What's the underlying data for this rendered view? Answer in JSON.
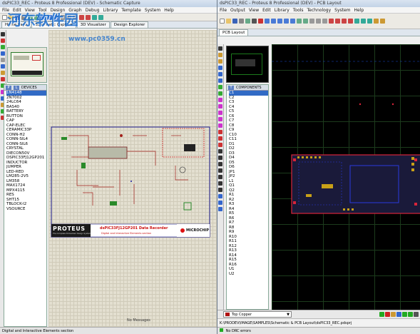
{
  "left": {
    "title": "dsPIC33_REC - Proteus 8 Professional (DEV) - Schematic Capture",
    "menu": [
      "File",
      "Edit",
      "View",
      "Tool",
      "Design",
      "Graph",
      "Debug",
      "Library",
      "Template",
      "System",
      "Help"
    ],
    "tabs": [
      {
        "label": "Home Page",
        "active": false
      },
      {
        "label": "Schematic Capture",
        "active": true
      },
      {
        "label": "3D Visualizer",
        "active": false
      },
      {
        "label": "Design Explorer",
        "active": false
      }
    ],
    "devices_header": "DEVICES",
    "devices_btn_p": "P",
    "devices_btn_l": "L",
    "devices": [
      "1N4148",
      "2N7002",
      "24LC64",
      "BAS40",
      "BATTERY",
      "BUTTON",
      "CAP",
      "CAP-ELEC",
      "CERAMIC33P",
      "CONN-H2",
      "CONN-SIL4",
      "CONN-SIL6",
      "CRYSTAL",
      "DIECON50V",
      "DSPIC33FJ12GP201",
      "INDUCTOR",
      "JUMPER",
      "LED-RED",
      "LM285-2V5",
      "LM358",
      "MAX1724",
      "MPX4115",
      "RES",
      "SHT15",
      "TBLOCK-I2",
      "VSOURCE"
    ],
    "selected_device": "1N4148",
    "banner_logo": "PROTEUS",
    "banner_tagline": "The Complete Embedded Design System",
    "banner_title": "dsPIC33FJ12GP201 Data Recorder",
    "banner_subtitle": "Digital and Interactive Elements section",
    "banner_brand": "MICROCHIP",
    "status_messages": "No Messages",
    "status_sheet": "Digital and Interactive Elements section"
  },
  "right": {
    "title": "dsPIC33_REC - Proteus 8 Professional (DEV) - PCB Layout",
    "menu": [
      "File",
      "Output",
      "View",
      "Edit",
      "Library",
      "Tools",
      "Technology",
      "System",
      "Help"
    ],
    "tab": "PCB Layout",
    "components_header": "COMPONENTS",
    "components_btn_t": "T",
    "components": [
      "C1",
      "C2",
      "C3",
      "C4",
      "C5",
      "C6",
      "C7",
      "C8",
      "C9",
      "C10",
      "C11",
      "D1",
      "D2",
      "D3",
      "D4",
      "D5",
      "D6",
      "JP1",
      "JP2",
      "L1",
      "Q1",
      "Q2",
      "R1",
      "R2",
      "R3",
      "R4",
      "R5",
      "R6",
      "R7",
      "R8",
      "R9",
      "R10",
      "R11",
      "R12",
      "R13",
      "R14",
      "R15",
      "R16",
      "U1",
      "U2"
    ],
    "selected_component": "C1",
    "layer": "Top Copper",
    "path": "K:\\PRODEV\\IMAGE\\SAMPLES\\Schematic & PCB Layout\\dsPIC33_REC.pdsprj",
    "status": "No DRC errors"
  },
  "watermark": "河东软件园",
  "watermark_url": "www.pc0359.cn",
  "colors": {
    "sch_bg": "#e3dfd0",
    "pcb_bg": "#000000",
    "wire": "#a3201a",
    "board_border": "#d8243a",
    "gold": "#c8a018",
    "selection": "#316ac5"
  }
}
